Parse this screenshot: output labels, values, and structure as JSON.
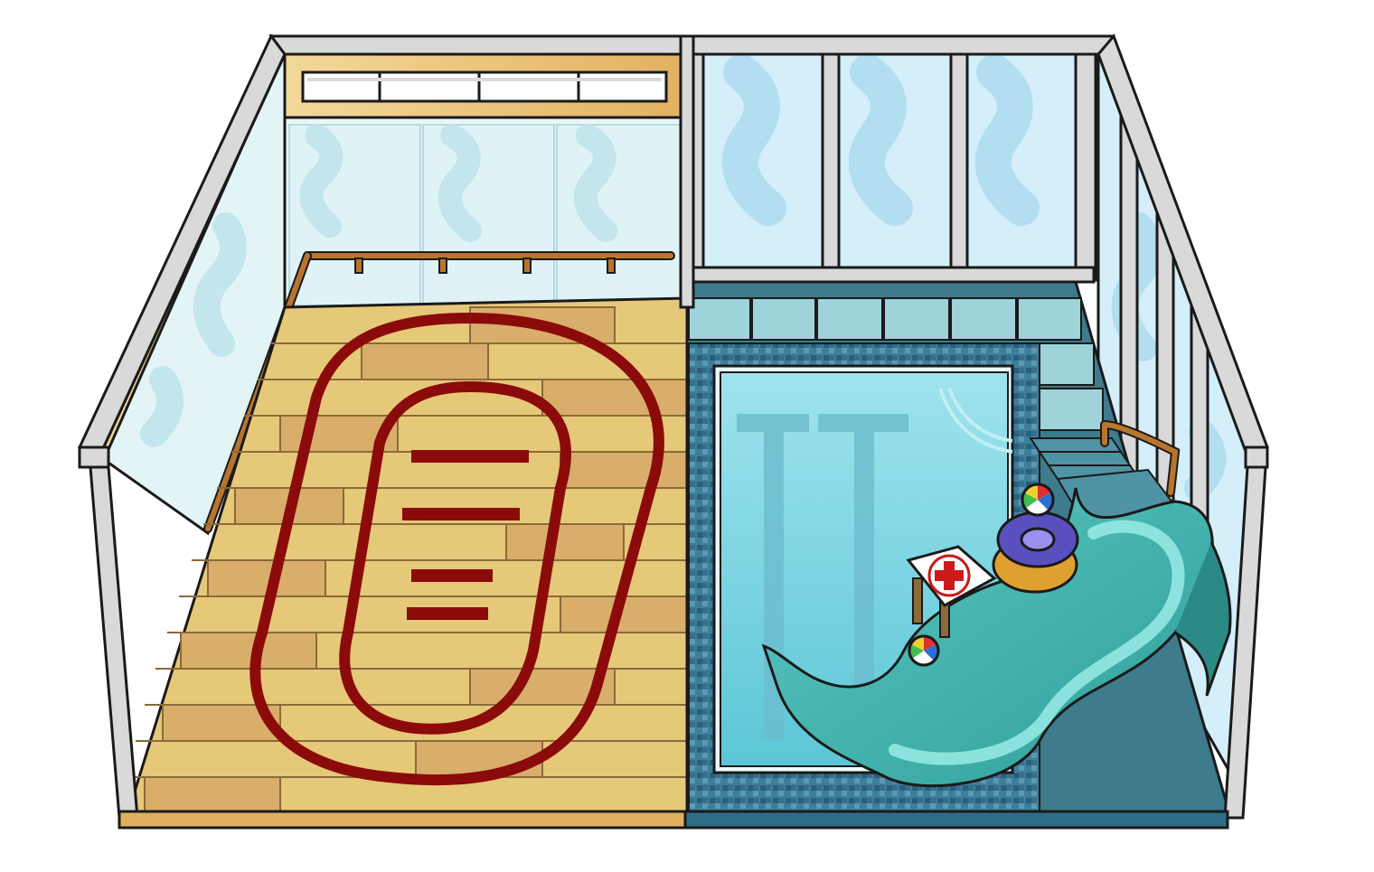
{
  "scene": {
    "description_name": "igloo-room-gym-and-pool",
    "colors": {
      "outline": "#1a1a1a",
      "frame": "#d9d9d9",
      "frame_shadow": "#9a9a9a",
      "wood_light": "#e6c879",
      "wood_mid": "#d8ae6a",
      "wood_dark": "#c9955a",
      "track_red": "#8b0a0a",
      "glass": "#dff3f7",
      "glass_swirl": "#bfe4ee",
      "sky_glass": "#cfeef8",
      "pool_water": "#7fd6e3",
      "pool_deep": "#4fb9cc",
      "tile_dark": "#2f6d87",
      "deck_tile": "#9fd3da",
      "slide": "#3fb3ad",
      "slide_dark": "#2b8a86",
      "rail_wood": "#b8752e",
      "floor_blue": "#3e7b8c"
    },
    "icons": [
      "first-aid-cross-icon",
      "beach-ball-icon",
      "swim-ring-icon"
    ]
  }
}
